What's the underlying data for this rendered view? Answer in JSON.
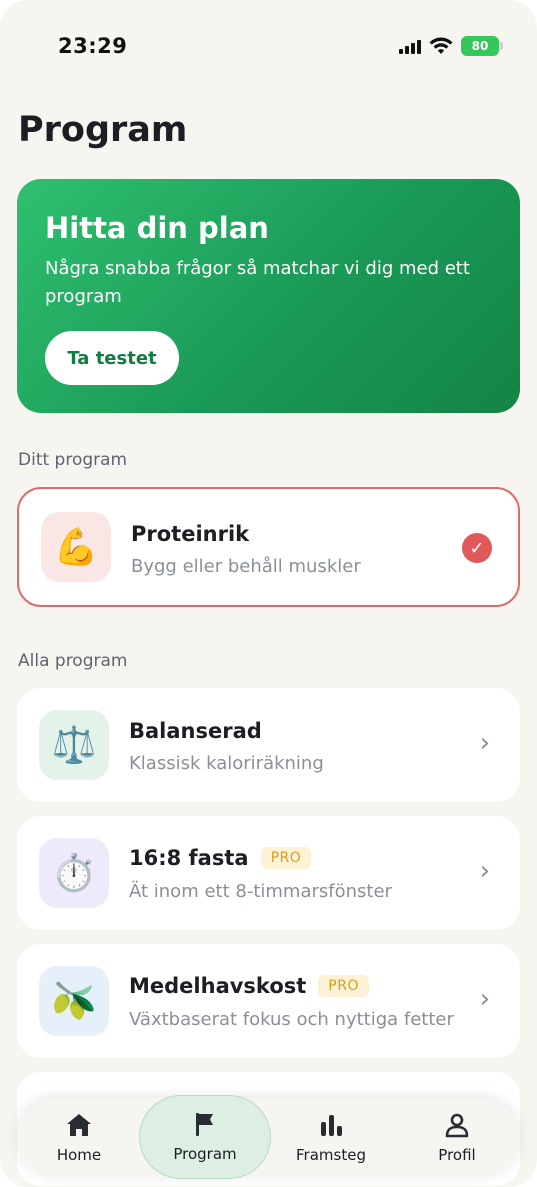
{
  "status_bar": {
    "time": "23:29",
    "battery": "80"
  },
  "page_title": "Program",
  "hero": {
    "title": "Hitta din plan",
    "subtitle": "Några snabba frågor så matchar vi dig med ett program",
    "button_label": "Ta testet",
    "colors": [
      "#2fc06f",
      "#138446"
    ]
  },
  "my_program": {
    "section_label": "Ditt program",
    "item": {
      "icon": "flexed-biceps-icon",
      "emoji": "💪",
      "title": "Proteinrik",
      "subtitle": "Bygg eller behåll muskler",
      "selected": true
    }
  },
  "all_programs": {
    "section_label": "Alla program",
    "items": [
      {
        "icon": "balance-scale-icon",
        "emoji": "⚖️",
        "title": "Balanserad",
        "subtitle": "Klassisk kaloriräkning",
        "badge": ""
      },
      {
        "icon": "stopwatch-icon",
        "emoji": "⏱️",
        "title": "16:8 fasta",
        "subtitle": "Ät inom ett 8-timmarsfönster",
        "badge": "PRO"
      },
      {
        "icon": "olive-icon",
        "emoji": "🫒",
        "title": "Medelhavskost",
        "subtitle": "Växtbaserat fokus och nyttiga fetter",
        "badge": "PRO"
      }
    ]
  },
  "nav": {
    "items": [
      {
        "label": "Home",
        "icon": "home-icon"
      },
      {
        "label": "Program",
        "icon": "flag-icon",
        "active": true
      },
      {
        "label": "Framsteg",
        "icon": "bar-chart-icon"
      },
      {
        "label": "Profil",
        "icon": "person-icon"
      }
    ]
  },
  "accent_colors": {
    "green": "#1a9a57",
    "selected_border": "#e06a6a",
    "pro_badge": "#d9a024"
  }
}
